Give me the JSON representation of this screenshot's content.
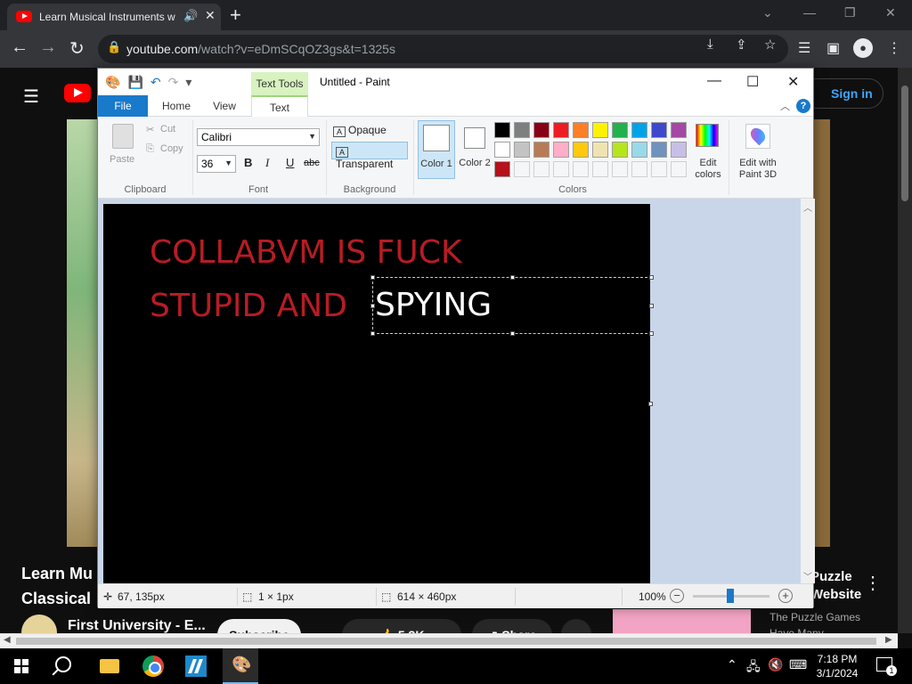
{
  "browser": {
    "tab_title": "Learn Musical Instruments w",
    "audio_icon": "speaker-icon",
    "new_tab": "+",
    "url_domain": "youtube.com",
    "url_rest": "/watch?v=eDmSCqOZ3gs&t=1325s"
  },
  "youtube": {
    "signin": "Sign in",
    "video_title_lines": [
      "Learn Mu",
      "Classical"
    ],
    "channel": "First University - E...",
    "subscribe": "Subscribe",
    "likes": "5.3K",
    "share": "Share",
    "side_title_lines": [
      "Puzzle",
      "Website"
    ],
    "side_desc_lines": [
      "The Puzzle Games",
      "Have Many"
    ]
  },
  "paint": {
    "context_tab": "Text Tools",
    "window_title": "Untitled - Paint",
    "tabs": {
      "file": "File",
      "home": "Home",
      "view": "View",
      "text": "Text"
    },
    "clipboard": {
      "paste": "Paste",
      "cut": "Cut",
      "copy": "Copy",
      "label": "Clipboard"
    },
    "font": {
      "name": "Calibri",
      "size": "36",
      "bold": "B",
      "italic": "I",
      "underline": "U",
      "strike": "abc",
      "label": "Font"
    },
    "background": {
      "opaque": "Opaque",
      "transparent": "Transparent",
      "label": "Background"
    },
    "colors": {
      "color1": "Color 1",
      "color2": "Color 2",
      "edit": "Edit colors",
      "paint3d": "Edit with Paint 3D",
      "label": "Colors",
      "row1": [
        "#000000",
        "#7f7f7f",
        "#880015",
        "#ed1c24",
        "#ff7f27",
        "#fff200",
        "#22b14c",
        "#00a2e8",
        "#3f48cc",
        "#a349a4"
      ],
      "row2": [
        "#ffffff",
        "#c3c3c3",
        "#b97a57",
        "#ffaec9",
        "#ffc90e",
        "#efe4b0",
        "#b5e61d",
        "#99d9ea",
        "#7092be",
        "#c8bfe7"
      ],
      "row3": [
        "#b5121b",
        "",
        "",
        "",
        "",
        "",
        "",
        "",
        "",
        ""
      ]
    },
    "canvas": {
      "line1": "COLLABVM IS FUCK",
      "line2a": "STUPID AND",
      "line2b": "SPYING",
      "text_color": "#b81c24"
    },
    "status": {
      "cursor": "67, 135px",
      "selection": "1 × 1px",
      "canvas_size": "614 × 460px",
      "zoom": "100%"
    }
  },
  "taskbar": {
    "time": "7:18 PM",
    "date": "3/1/2024",
    "notifications": "1"
  }
}
